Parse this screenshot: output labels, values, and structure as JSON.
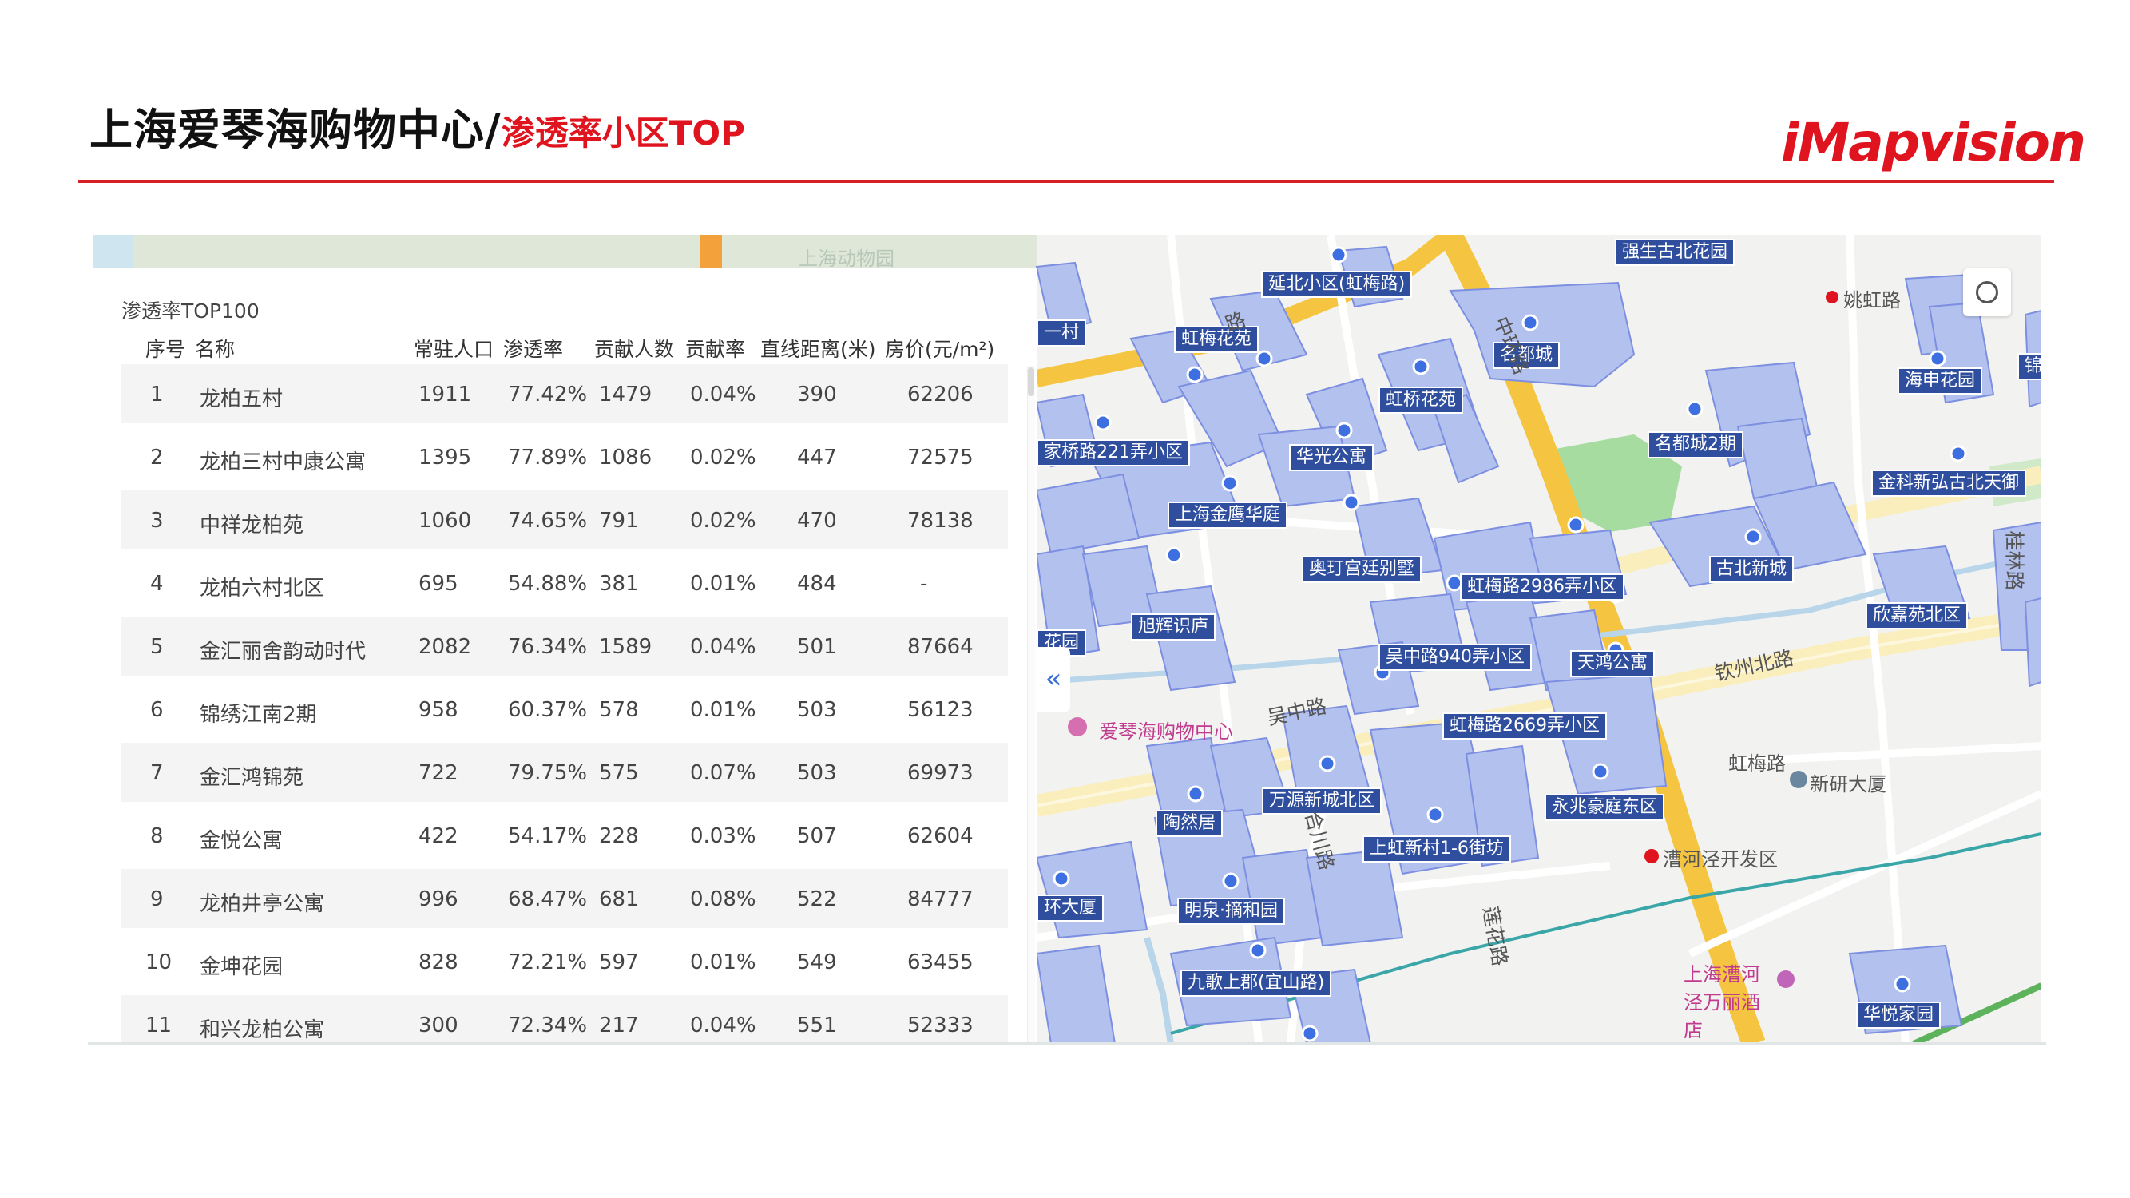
{
  "header": {
    "title": "上海爱琴海购物中心/",
    "subtitle": "渗透率小区TOP",
    "logo_text": "iMapvision",
    "accent_color": "#e0141e"
  },
  "table": {
    "title": "渗透率TOP100",
    "columns": [
      "序号",
      "名称",
      "常驻人口",
      "渗透率",
      "贡献人数",
      "贡献率",
      "直线距离(米)",
      "房价(元/m²)"
    ],
    "rows": [
      [
        "1",
        "龙柏五村",
        "1911",
        "77.42%",
        "1479",
        "0.04%",
        "390",
        "62206"
      ],
      [
        "2",
        "龙柏三村中康公寓",
        "1395",
        "77.89%",
        "1086",
        "0.02%",
        "447",
        "72575"
      ],
      [
        "3",
        "中祥龙柏苑",
        "1060",
        "74.65%",
        "791",
        "0.02%",
        "470",
        "78138"
      ],
      [
        "4",
        "龙柏六村北区",
        "695",
        "54.88%",
        "381",
        "0.01%",
        "484",
        "-"
      ],
      [
        "5",
        "金汇丽舍韵动时代",
        "2082",
        "76.34%",
        "1589",
        "0.04%",
        "501",
        "87664"
      ],
      [
        "6",
        "锦绣江南2期",
        "958",
        "60.37%",
        "578",
        "0.01%",
        "503",
        "56123"
      ],
      [
        "7",
        "金汇鸿锦苑",
        "722",
        "79.75%",
        "575",
        "0.07%",
        "503",
        "69973"
      ],
      [
        "8",
        "金悦公寓",
        "422",
        "54.17%",
        "228",
        "0.03%",
        "507",
        "62604"
      ],
      [
        "9",
        "龙柏井亭公寓",
        "996",
        "68.47%",
        "681",
        "0.08%",
        "522",
        "84777"
      ],
      [
        "10",
        "金坤花园",
        "828",
        "72.21%",
        "597",
        "0.01%",
        "549",
        "63455"
      ],
      [
        "11",
        "和兴龙柏公寓",
        "300",
        "72.34%",
        "217",
        "0.04%",
        "551",
        "52333"
      ]
    ]
  },
  "map": {
    "collapse_icon": "«",
    "locate_icon": "circle-icon",
    "labels": [
      "强生古北花园",
      "延北小区(虹梅路)",
      "虹梅花苑",
      "名都城",
      "海申花园",
      "虹桥花苑",
      "名都城2期",
      "家桥路221弄小区",
      "华光公寓",
      "金科新弘古北天御",
      "上海金鹰华庭",
      "奥玎宫廷别墅",
      "古北新城",
      "虹梅路2986弄小区",
      "欣嘉苑北区",
      "旭辉识庐",
      "吴中路940弄小区",
      "天鸿公寓",
      "虹梅路2669弄小区",
      "万源新城北区",
      "陶然居",
      "永兆豪庭东区",
      "上虹新村1-6街坊",
      "明泉·摘和园",
      "九歌上郡(宜山路)",
      "华悦家园",
      "一村",
      "花园",
      "环大厦",
      "锦"
    ],
    "pois": [
      "上海动物园",
      "姚虹路",
      "爱琴海购物中心",
      "虹梅路",
      "新研大厦",
      "漕河泾开发区",
      "上海漕河泾万丽酒店"
    ],
    "roads": [
      "吴中路",
      "钦州北路",
      "中环路",
      "合川路",
      "莲花路",
      "桂林路",
      "路"
    ]
  }
}
